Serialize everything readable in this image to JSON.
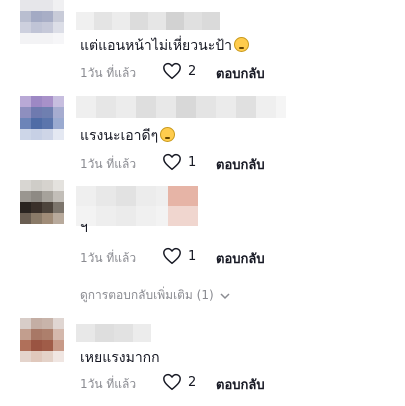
{
  "comments": [
    {
      "text": "แต่แอนหน้าไม่เหี่ยวนะป้า",
      "emoji": "flushed-face-emoji",
      "time": "1วัน ที่แล้ว",
      "likes": "2",
      "reply_label": "ตอบกลับ"
    },
    {
      "text": "แรงนะเอาดีๆ",
      "emoji": "worried-face-emoji",
      "time": "1วัน ที่แล้ว",
      "likes": "1",
      "reply_label": "ตอบกลับ"
    },
    {
      "text": "ฯ",
      "time": "1วัน ที่แล้ว",
      "likes": "1",
      "reply_label": "ตอบกลับ"
    },
    {
      "text": "เหยแรงมากก",
      "time": "1วัน ที่แล้ว",
      "likes": "2",
      "reply_label": "ตอบกลับ"
    }
  ],
  "view_more_replies": "ดูการตอบกลับเพิ่มเติม (1)",
  "icons": {
    "like": "heart-outline-icon",
    "expand": "chevron-down-icon"
  },
  "colors": {
    "text": "#161823",
    "muted": "#8a8b91"
  }
}
